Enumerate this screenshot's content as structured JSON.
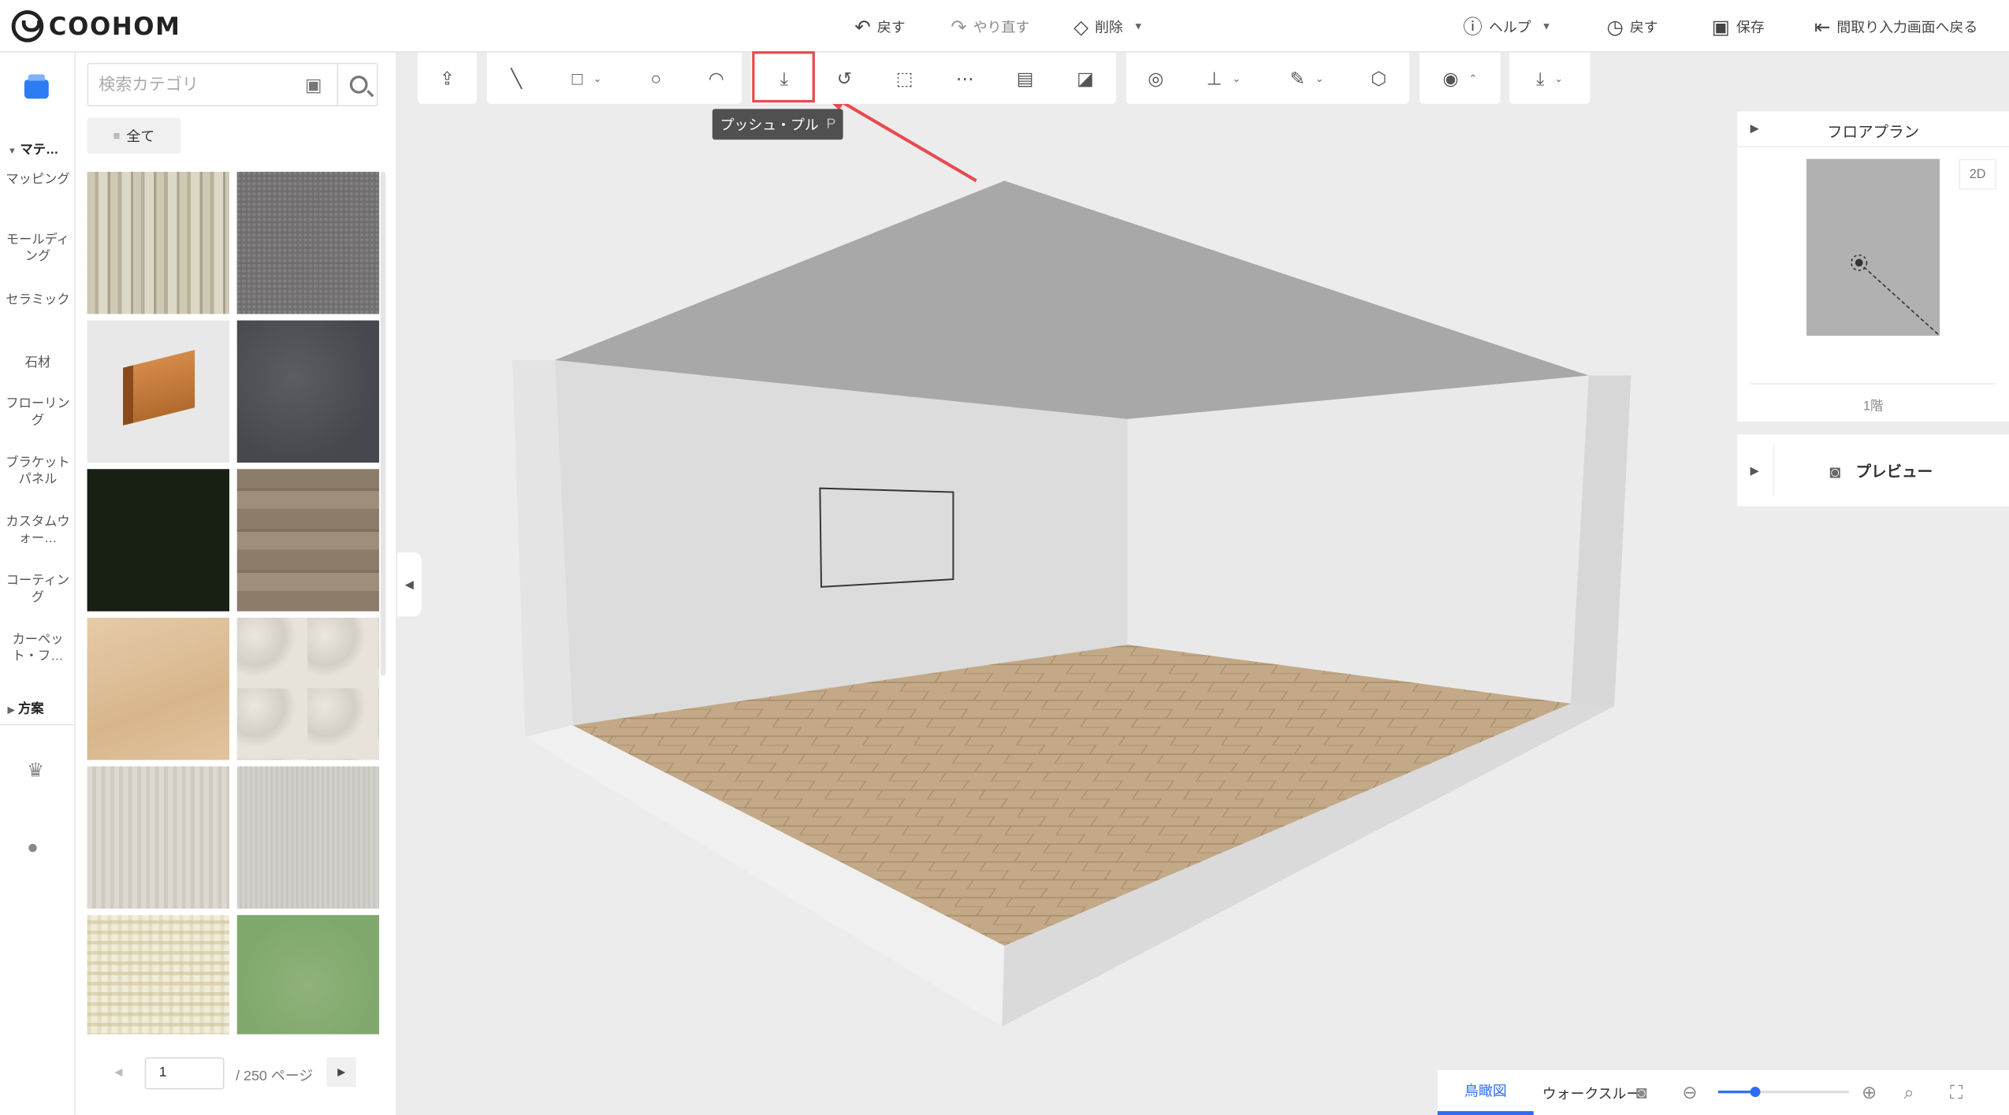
{
  "app": {
    "logo_text": "COOHOM"
  },
  "topbar": {
    "undo": "戻す",
    "redo": "やり直す",
    "delete": "削除",
    "help": "ヘルプ",
    "history": "戻す",
    "save": "保存",
    "back_to_floorplan": "間取り入力画面へ戻る"
  },
  "rail": {
    "section_materials": "マテ…",
    "items": [
      "マッピング",
      "モールディング",
      "セラミック",
      "石材",
      "フローリング",
      "ブラケットパネル",
      "カスタムウォー…",
      "コーティング",
      "カーペット・フ…"
    ],
    "section_plans": "方案"
  },
  "panel": {
    "search_placeholder": "検索カテゴリ",
    "all_label": "全て",
    "tiles": [
      "wood-grain",
      "gray-fabric",
      "wood-molding",
      "dark-stone",
      "dark-green",
      "oak-plank",
      "light-wood",
      "marble-tile",
      "pale-wood",
      "light-gray",
      "check-pattern",
      "green-wall"
    ],
    "page_current": "1",
    "page_total": "/ 250 ページ"
  },
  "toolbar": {
    "tools": [
      "upload-icon",
      "line-icon",
      "rectangle-icon",
      "circle-icon",
      "arc-icon",
      "push-pull-icon",
      "follow-me-icon",
      "offset-icon",
      "array-icon",
      "panel-icon",
      "split-icon",
      "camera-orbit-icon",
      "align-icon",
      "material-brush-icon",
      "component-icon",
      "visibility-icon",
      "download-icon"
    ],
    "tooltip_label": "プッシュ・プル",
    "tooltip_key": "P"
  },
  "right": {
    "floorplan_title": "フロアプラン",
    "view_2d": "2D",
    "floor_label": "1階",
    "preview_title": "プレビュー"
  },
  "bottom": {
    "tab_bird": "鳥瞰図",
    "tab_walk": "ウォークスルー",
    "zoom_level": 0.28
  },
  "colors": {
    "accent": "#2d6cf6",
    "highlight": "#e84a4f",
    "canvas_bg": "#ececec"
  }
}
